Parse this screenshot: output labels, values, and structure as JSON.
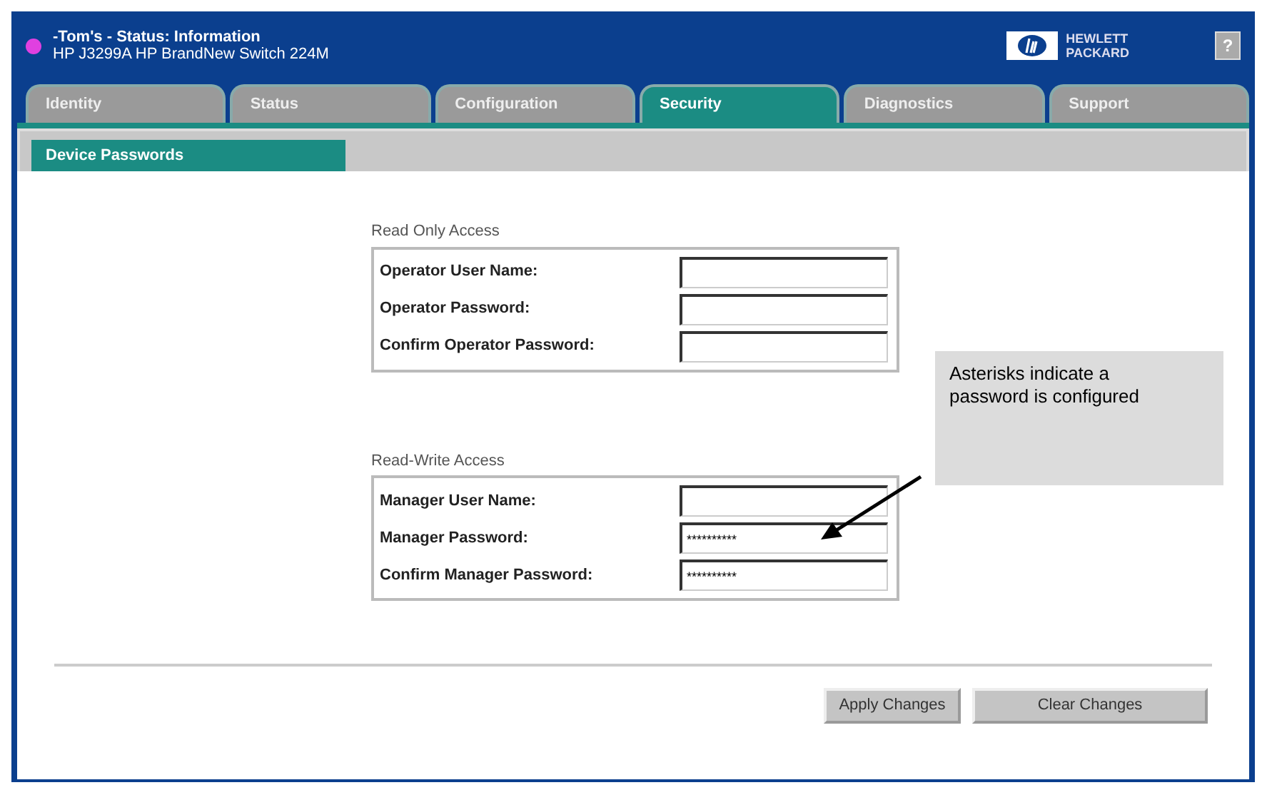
{
  "header": {
    "title": "-Tom's - Status: Information",
    "subtitle": "HP J3299A HP BrandNew Switch 224M",
    "logo_lines": [
      "HEWLETT",
      "PACKARD"
    ],
    "help": "?"
  },
  "tabs": [
    {
      "label": "Identity",
      "selected": false
    },
    {
      "label": "Status",
      "selected": false
    },
    {
      "label": "Configuration",
      "selected": false
    },
    {
      "label": "Security",
      "selected": true
    },
    {
      "label": "Diagnostics",
      "selected": false
    },
    {
      "label": "Support",
      "selected": false
    }
  ],
  "section_title": "Device Passwords",
  "groups": [
    {
      "title": "Read Only Access",
      "fields": [
        {
          "label": "Operator User Name:"
        },
        {
          "label": "Operator Password:"
        },
        {
          "label": "Confirm Operator Password:"
        }
      ]
    },
    {
      "title": "Read-Write Access",
      "fields": [
        {
          "label": "Manager User Name:"
        },
        {
          "label": "Manager Password:",
          "value": "**********"
        },
        {
          "label": "Confirm Manager Password:",
          "value": "**********"
        }
      ]
    }
  ],
  "buttons": [
    "Apply Changes",
    "Clear Changes"
  ],
  "callout": "Asterisks indicate a password is configured"
}
